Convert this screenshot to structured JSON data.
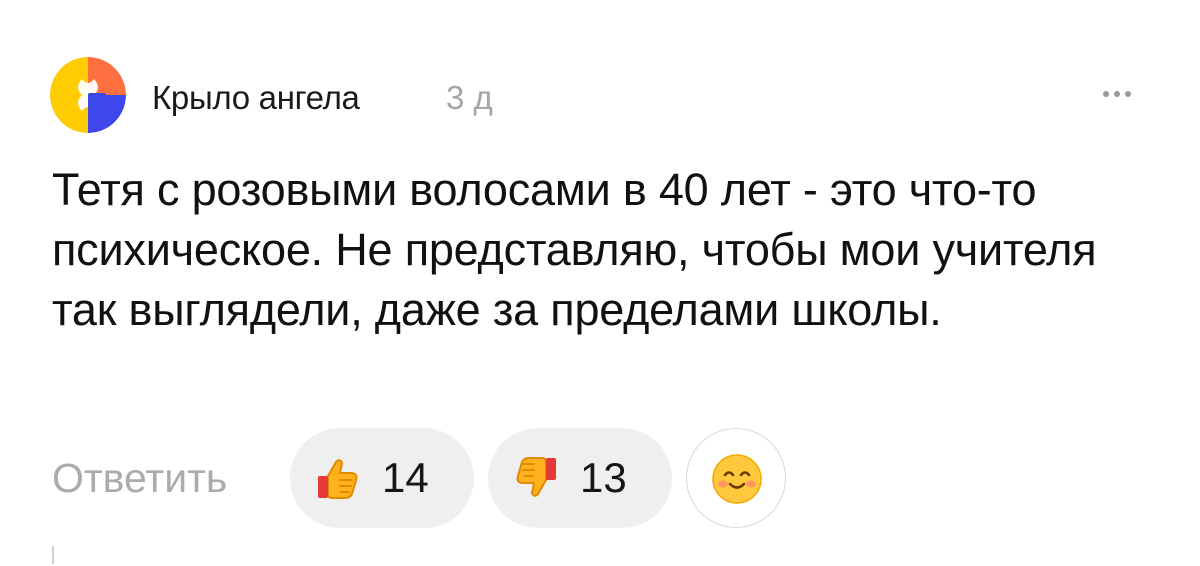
{
  "comment": {
    "author": "Крыло ангела",
    "time": "3 д",
    "text": "Тетя с розовыми волосами в 40 лет - это что-то психическое. Не представляю, чтобы мои учителя так выглядели, даже за пределами школы.",
    "reply_label": "Ответить",
    "likes": "14",
    "dislikes": "13",
    "avatar_icon": "yandex-zen-logo-icon",
    "menu_icon": "more-dots-icon",
    "like_icon": "thumbs-up-icon",
    "dislike_icon": "thumbs-down-icon",
    "reaction_icon": "smiling-face-icon"
  },
  "colors": {
    "avatar_yellow": "#FFCC00",
    "avatar_blue": "#3D47EA",
    "avatar_orange": "#FF7040",
    "avatar_gray": "#D6D6D6",
    "muted_text": "#ABABAB",
    "pill_background": "#EFEFEF"
  }
}
